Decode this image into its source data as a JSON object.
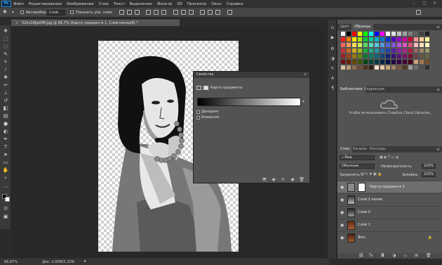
{
  "app": {
    "logo": "Ps"
  },
  "menu": [
    "Файл",
    "Редактирование",
    "Изображение",
    "Слои",
    "Текст",
    "Выделение",
    "Фильтр",
    "3D",
    "Просмотр",
    "Окно",
    "Справка"
  ],
  "window_controls": {
    "minimize": "–",
    "maximize": "▢",
    "close": "✕"
  },
  "options": {
    "autoselect_label": "Автовыбор:",
    "autoselect_value": "Слой",
    "show_controls_label": "Показать упр. элем."
  },
  "document": {
    "tab_title": "X2hv18Jqd0M.jpg @ 66,7% (Карта градиента 1, Слой-маска/8) *",
    "close_glyph": "×",
    "zoom": "66,67%",
    "doc_size": "Док: 2,00M/5,32M"
  },
  "properties": {
    "title": "Свойства",
    "subtitle": "Карта градиента",
    "dither_label": "Дизеринг",
    "reverse_label": "Инверсия",
    "menu_glyph": "≡"
  },
  "right_panel": {
    "tabs_top": [
      "Цвет",
      "Образцы"
    ],
    "tabs_mid": [
      "Библиотеки",
      "Коррекция"
    ],
    "cc_message": "Чтобы использовать Creative Cloud Libraries,",
    "tabs_layers": [
      "Слои",
      "Каналы",
      "Контуры"
    ],
    "filter_type": "Вид",
    "blend_mode": "Обычные",
    "opacity_label": "Непрозрачность:",
    "opacity_value": "100%",
    "lock_label": "Закрепить:",
    "fill_label": "Заливка:",
    "fill_value": "100%",
    "layers": [
      {
        "name": "Карта градиента 1",
        "selected": true
      },
      {
        "name": "Слой 2 копия",
        "selected": false
      },
      {
        "name": "Слой 2",
        "selected": false
      },
      {
        "name": "Слой 1",
        "selected": false
      },
      {
        "name": "Фон",
        "selected": false
      }
    ]
  },
  "colors": {
    "ui_bg": "#535353",
    "dark_bg": "#282828",
    "accent_logo": "#31a8ff"
  },
  "swatch_colors": [
    "#ffffff",
    "#000000",
    "#ff0000",
    "#ffff00",
    "#00ff00",
    "#00ffff",
    "#0000ff",
    "#ff00ff",
    "#ffffff",
    "#e0e0e0",
    "#c0c0c0",
    "#a0a0a0",
    "#808080",
    "#606060",
    "#404040",
    "#202020",
    "#ff1a1a",
    "#ff7a00",
    "#ffe600",
    "#a6e600",
    "#00cc33",
    "#00cc99",
    "#00b3cc",
    "#0077cc",
    "#0033cc",
    "#4d00cc",
    "#9900cc",
    "#cc0099",
    "#cc0033",
    "#ff9999",
    "#ffcc99",
    "#ffff99",
    "#ff6666",
    "#ff9955",
    "#ffdd55",
    "#ccee55",
    "#55dd66",
    "#55ddbb",
    "#55ccdd",
    "#5599dd",
    "#5566dd",
    "#8855dd",
    "#bb55dd",
    "#dd55bb",
    "#dd5577",
    "#ffbbbb",
    "#ffddbb",
    "#ffffbb",
    "#cc3333",
    "#cc6622",
    "#ccaa22",
    "#99bb22",
    "#22aa44",
    "#22aa88",
    "#2299aa",
    "#2266aa",
    "#2244aa",
    "#5522aa",
    "#8822aa",
    "#aa2288",
    "#aa2244",
    "#996666",
    "#998866",
    "#999966",
    "#992222",
    "#994411",
    "#997711",
    "#668811",
    "#117733",
    "#117766",
    "#116677",
    "#114477",
    "#112277",
    "#331177",
    "#551177",
    "#771166",
    "#771133",
    "#664444",
    "#665544",
    "#666644",
    "#661111",
    "#662200",
    "#664400",
    "#445500",
    "#004411",
    "#004433",
    "#003344",
    "#002244",
    "#001144",
    "#220044",
    "#330044",
    "#440033",
    "#440011",
    "#c8a078",
    "#a07850",
    "#785028",
    "#d9c3a5",
    "#b89a74",
    "#8f7050",
    "#6b4e33",
    "#4a3220",
    "#2e1e12",
    "#f0e0c8",
    "#e0c8a0",
    "#c8a878",
    "#a08060",
    "#785a40",
    "#503820",
    "#a0a0a0",
    "#707070",
    "#505050",
    "#303030"
  ]
}
